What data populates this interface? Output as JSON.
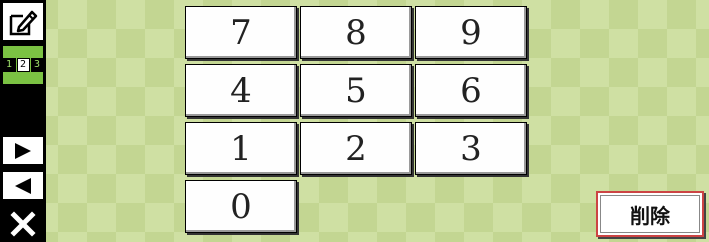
{
  "sidebar": {
    "edit_icon": "edit-pencil-icon",
    "mode_digits": [
      "1",
      "2",
      "3"
    ],
    "next_icon": "play-right-icon",
    "prev_icon": "play-left-icon",
    "close_icon": "close-x-icon"
  },
  "keypad": {
    "keys": [
      "7",
      "8",
      "9",
      "4",
      "5",
      "6",
      "1",
      "2",
      "3",
      "0"
    ]
  },
  "delete_label": "削除",
  "colors": {
    "background": "#cfe0a3",
    "checker": "#c3d692",
    "sidebar": "#000000",
    "mode_active": "#7bc243",
    "delete_border": "#cc4444"
  }
}
